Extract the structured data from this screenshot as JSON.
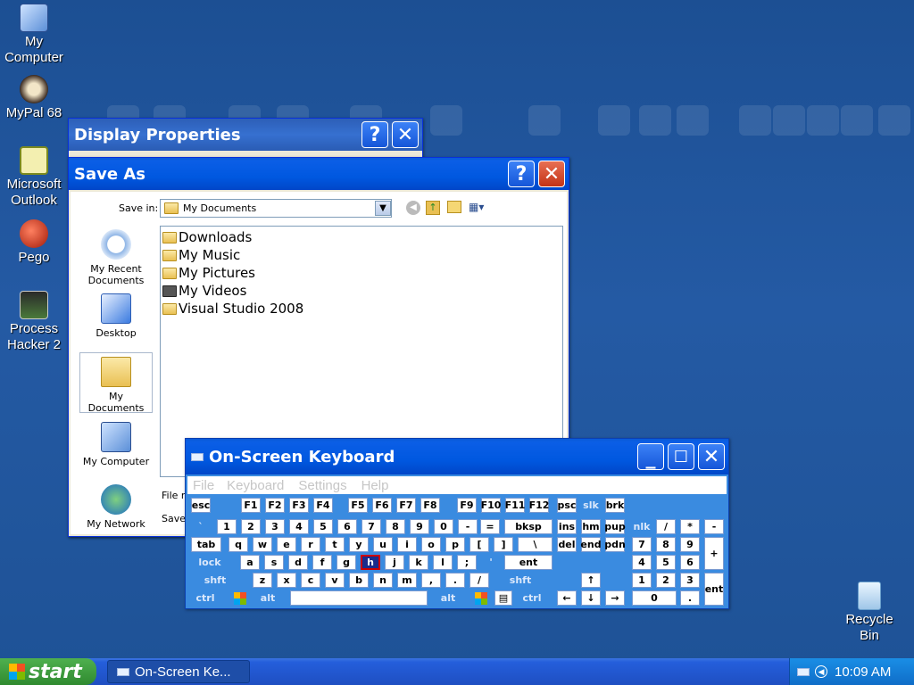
{
  "desktop": {
    "icons": [
      {
        "label_line1": "My",
        "label_line2": "Computer"
      },
      {
        "label_line1": "MyPal 68",
        "label_line2": ""
      },
      {
        "label_line1": "Microsoft",
        "label_line2": "Outlook"
      },
      {
        "label_line1": "Pego",
        "label_line2": ""
      },
      {
        "label_line1": "Process",
        "label_line2": "Hacker 2"
      },
      {
        "label_line1": "Recycle",
        "label_line2": "Bin"
      }
    ]
  },
  "display_properties": {
    "title": "Display Properties",
    "help": "?",
    "close": "✕"
  },
  "save_as": {
    "title": "Save As",
    "help": "?",
    "close": "✕",
    "save_in_label": "Save in:",
    "save_in_value": "My Documents",
    "places": [
      {
        "line1": "My Recent",
        "line2": "Documents"
      },
      {
        "line1": "Desktop",
        "line2": ""
      },
      {
        "line1": "My Documents",
        "line2": ""
      },
      {
        "line1": "My Computer",
        "line2": ""
      },
      {
        "line1": "My Network",
        "line2": ""
      }
    ],
    "files": [
      "Downloads",
      "My Music",
      "My Pictures",
      "My Videos",
      "Visual Studio 2008"
    ],
    "file_name_label": "File n",
    "save_type_label": "Save"
  },
  "osk": {
    "title": "On-Screen Keyboard",
    "minimize": "_",
    "maximize": "☐",
    "close": "✕",
    "menu": [
      "File",
      "Keyboard",
      "Settings",
      "Help"
    ],
    "rows": {
      "r1": [
        "esc",
        "F1",
        "F2",
        "F3",
        "F4",
        "F5",
        "F6",
        "F7",
        "F8",
        "F9",
        "F10",
        "F11",
        "F12",
        "psc",
        "slk",
        "brk"
      ],
      "r2": [
        "`",
        "1",
        "2",
        "3",
        "4",
        "5",
        "6",
        "7",
        "8",
        "9",
        "0",
        "-",
        "=",
        "bksp",
        "ins",
        "hm",
        "pup",
        "nlk",
        "/",
        "*",
        "-"
      ],
      "r3": [
        "tab",
        "q",
        "w",
        "e",
        "r",
        "t",
        "y",
        "u",
        "i",
        "o",
        "p",
        "[",
        "]",
        "\\",
        "del",
        "end",
        "pdn",
        "7",
        "8",
        "9",
        "+"
      ],
      "r4": [
        "lock",
        "a",
        "s",
        "d",
        "f",
        "g",
        "h",
        "j",
        "k",
        "l",
        ";",
        "'",
        "ent",
        "4",
        "5",
        "6"
      ],
      "r5": [
        "shft",
        "z",
        "x",
        "c",
        "v",
        "b",
        "n",
        "m",
        ",",
        ".",
        "/",
        "shft",
        "↑",
        "1",
        "2",
        "3",
        "ent"
      ],
      "r6": [
        "ctrl",
        "alt",
        "alt",
        "ctrl",
        "←",
        "↓",
        "→",
        "0",
        "."
      ]
    }
  },
  "taskbar": {
    "start_label": "start",
    "task_label": "On-Screen Ke...",
    "clock": "10:09 AM"
  },
  "colors": {
    "accent": "#0058e0",
    "taskbar": "#245edb",
    "start": "#3c9a3c"
  }
}
